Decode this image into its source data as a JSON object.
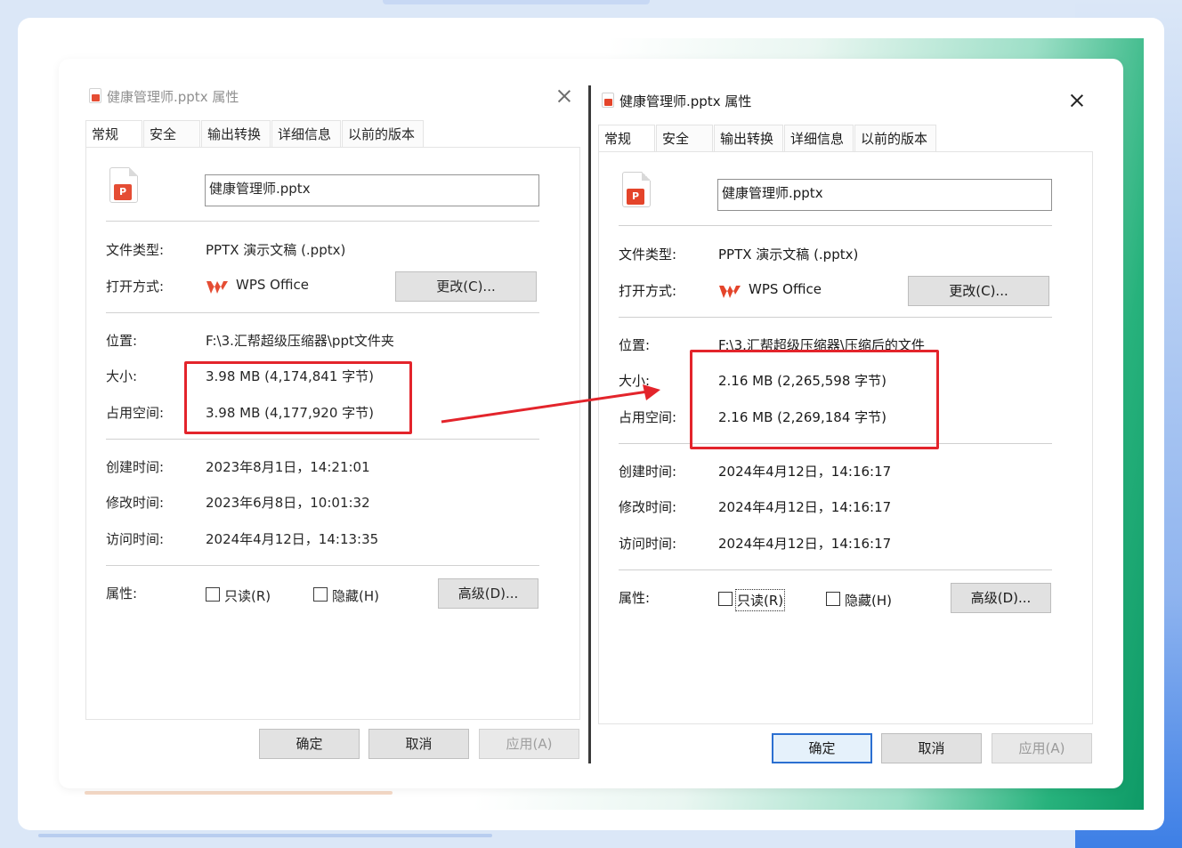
{
  "colors": {
    "highlight": "#e3242b",
    "accent_blue": "#2b6fd1",
    "pptx_red": "#e4442a",
    "wps_red": "#e4442a"
  },
  "left": {
    "title": "健康管理师.pptx 属性",
    "tabs": [
      "常规",
      "安全",
      "输出转换",
      "详细信息",
      "以前的版本"
    ],
    "filename": "健康管理师.pptx",
    "file_badge": "P",
    "labels": {
      "type": "文件类型:",
      "opens_with": "打开方式:",
      "location": "位置:",
      "size": "大小:",
      "size_on_disk": "占用空间:",
      "created": "创建时间:",
      "modified": "修改时间:",
      "accessed": "访问时间:",
      "attributes": "属性:"
    },
    "values": {
      "type": "PPTX 演示文稿 (.pptx)",
      "opens_with": "WPS Office",
      "location": "F:\\3.汇帮超级压缩器\\ppt文件夹",
      "size": "3.98 MB (4,174,841 字节)",
      "size_on_disk": "3.98 MB (4,177,920 字节)",
      "created": "2023年8月1日，14:21:01",
      "modified": "2023年6月8日，10:01:32",
      "accessed": "2024年4月12日，14:13:35"
    },
    "buttons": {
      "change": "更改(C)...",
      "advanced": "高级(D)...",
      "ok": "确定",
      "cancel": "取消",
      "apply": "应用(A)"
    },
    "checkboxes": {
      "readonly": "只读(R)",
      "hidden": "隐藏(H)"
    }
  },
  "right": {
    "title": "健康管理师.pptx 属性",
    "tabs": [
      "常规",
      "安全",
      "输出转换",
      "详细信息",
      "以前的版本"
    ],
    "filename": "健康管理师.pptx",
    "file_badge": "P",
    "labels": {
      "type": "文件类型:",
      "opens_with": "打开方式:",
      "location": "位置:",
      "size": "大小:",
      "size_on_disk": "占用空间:",
      "created": "创建时间:",
      "modified": "修改时间:",
      "accessed": "访问时间:",
      "attributes": "属性:"
    },
    "values": {
      "type": "PPTX 演示文稿 (.pptx)",
      "opens_with": "WPS Office",
      "location": "F:\\3.汇帮超级压缩器\\压缩后的文件",
      "size": "2.16 MB (2,265,598 字节)",
      "size_on_disk": "2.16 MB (2,269,184 字节)",
      "created": "2024年4月12日，14:16:17",
      "modified": "2024年4月12日，14:16:17",
      "accessed": "2024年4月12日，14:16:17"
    },
    "buttons": {
      "change": "更改(C)...",
      "advanced": "高级(D)...",
      "ok": "确定",
      "cancel": "取消",
      "apply": "应用(A)"
    },
    "checkboxes": {
      "readonly": "只读(R)",
      "hidden": "隐藏(H)"
    }
  }
}
